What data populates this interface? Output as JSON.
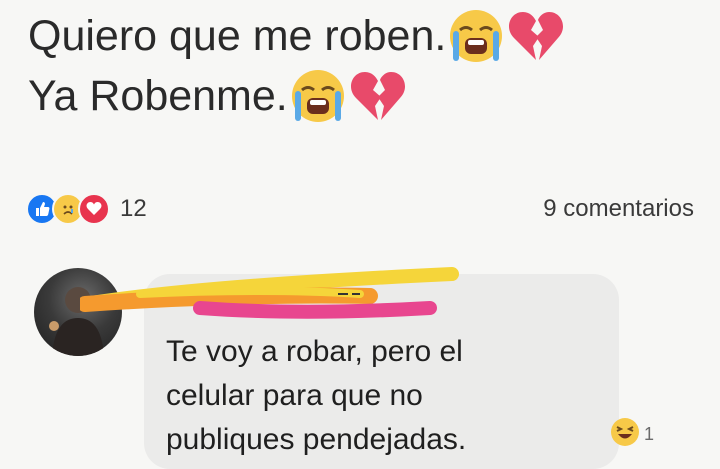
{
  "post": {
    "lines": [
      {
        "text": "Quiero que me roben.",
        "emojis": [
          "crying-face-icon",
          "broken-heart-icon"
        ]
      },
      {
        "text": "Ya Robenme.",
        "emojis": [
          "crying-face-icon",
          "broken-heart-icon"
        ]
      }
    ]
  },
  "reactions": {
    "icons": [
      "like-icon",
      "sad-face-icon",
      "love-icon"
    ],
    "count": "12"
  },
  "comments_count": "9 comentarios",
  "comment": {
    "text": "Te voy a robar, pero el\ncelular para que no\npubliques pendejadas.",
    "reaction_icon": "laughing-face-icon",
    "reaction_count": "1"
  },
  "colors": {
    "like_blue": "#1877f2",
    "love_red": "#e8344e",
    "emoji_yellow": "#f7c948",
    "broken_heart_pink": "#e84a6a",
    "scribble_yellow": "#f5d53a",
    "scribble_orange": "#f59a2e",
    "scribble_pink": "#e8468f"
  }
}
